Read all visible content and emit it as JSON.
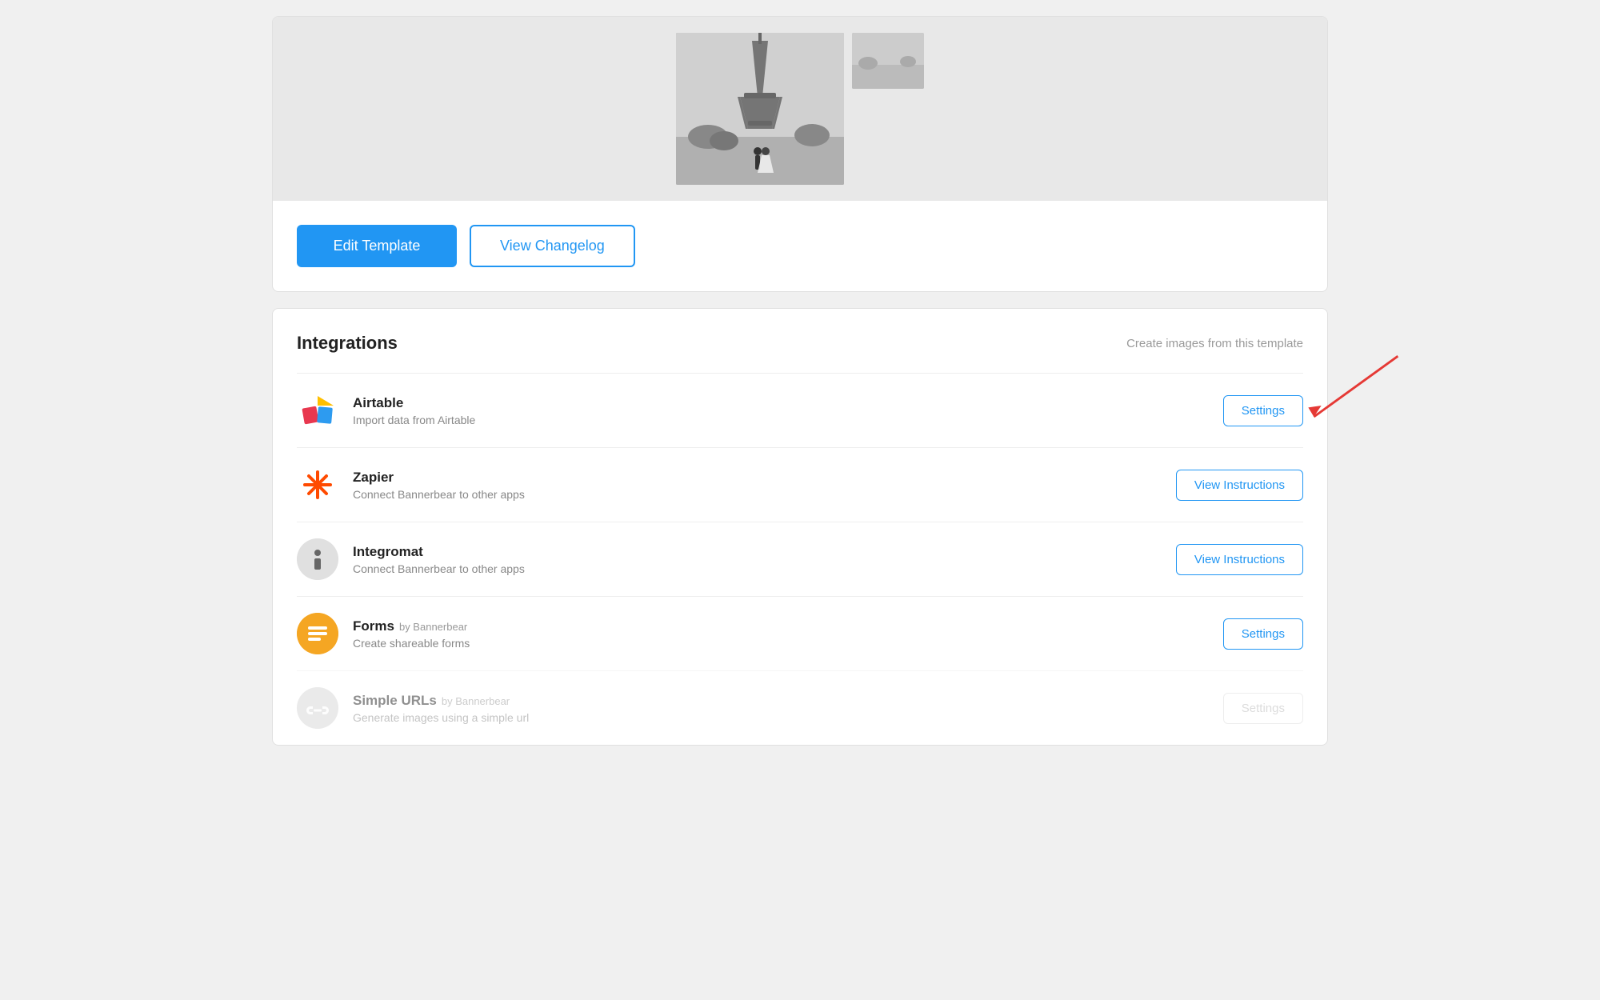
{
  "page": {
    "background": "#f0f0f0"
  },
  "image_section": {
    "alt": "Wedding photo at Eiffel Tower"
  },
  "action_buttons": {
    "edit_template": "Edit Template",
    "view_changelog": "View Changelog"
  },
  "integrations": {
    "title": "Integrations",
    "subtitle": "Create images from this template",
    "items": [
      {
        "id": "airtable",
        "name": "Airtable",
        "by": "",
        "description": "Import data from Airtable",
        "button_label": "Settings",
        "button_type": "action",
        "icon_type": "airtable"
      },
      {
        "id": "zapier",
        "name": "Zapier",
        "by": "",
        "description": "Connect Bannerbear to other apps",
        "button_label": "View Instructions",
        "button_type": "action",
        "icon_type": "zapier"
      },
      {
        "id": "integromat",
        "name": "Integromat",
        "by": "",
        "description": "Connect Bannerbear to other apps",
        "button_label": "View Instructions",
        "button_type": "action",
        "icon_type": "integromat"
      },
      {
        "id": "forms",
        "name": "Forms",
        "by": "by Bannerbear",
        "description": "Create shareable forms",
        "button_label": "Settings",
        "button_type": "action",
        "icon_type": "forms"
      },
      {
        "id": "simple-urls",
        "name": "Simple URLs",
        "by": "by Bannerbear",
        "description": "Generate images using a simple url",
        "button_label": "Settings",
        "button_type": "disabled",
        "icon_type": "simple-urls"
      }
    ]
  },
  "arrow_annotation": {
    "color": "#e53935"
  }
}
